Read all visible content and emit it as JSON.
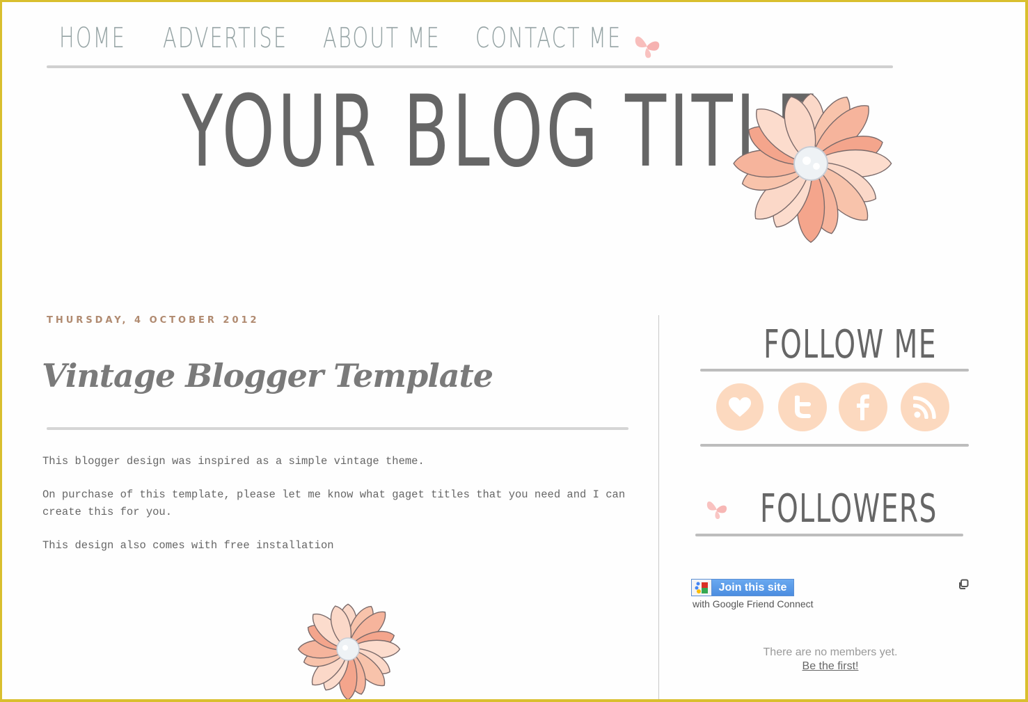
{
  "nav": {
    "items": [
      {
        "label": "HOME"
      },
      {
        "label": "ADVERTISE"
      },
      {
        "label": "ABOUT ME"
      },
      {
        "label": "CONTACT ME"
      }
    ]
  },
  "header": {
    "title": "YOUR BLOG TITLE"
  },
  "post": {
    "date": "THURSDAY, 4 OCTOBER 2012",
    "title": "Vintage Blogger Template",
    "paragraphs": [
      "This blogger design was inspired as a simple vintage theme.",
      "On purchase of this template, please let me know what gaget titles that you need and I can create this for you.",
      "This design also comes with free installation"
    ]
  },
  "sidebar": {
    "follow": {
      "title": "FOLLOW ME",
      "icons": [
        "heart-icon",
        "twitter-icon",
        "facebook-icon",
        "rss-icon"
      ]
    },
    "followers": {
      "title": "FOLLOWERS",
      "join_label": "Join this site",
      "gfc_text": "with Google Friend Connect",
      "no_members": "There are no members yet.",
      "be_first": "Be the first!"
    }
  },
  "colors": {
    "frame_border": "#d9bf2e",
    "social_circle": "#fcd9bf",
    "nav_text": "#95a3a4",
    "title_text": "#666666",
    "date_text": "#b08a70",
    "flower_petal": "#f6b49c"
  }
}
